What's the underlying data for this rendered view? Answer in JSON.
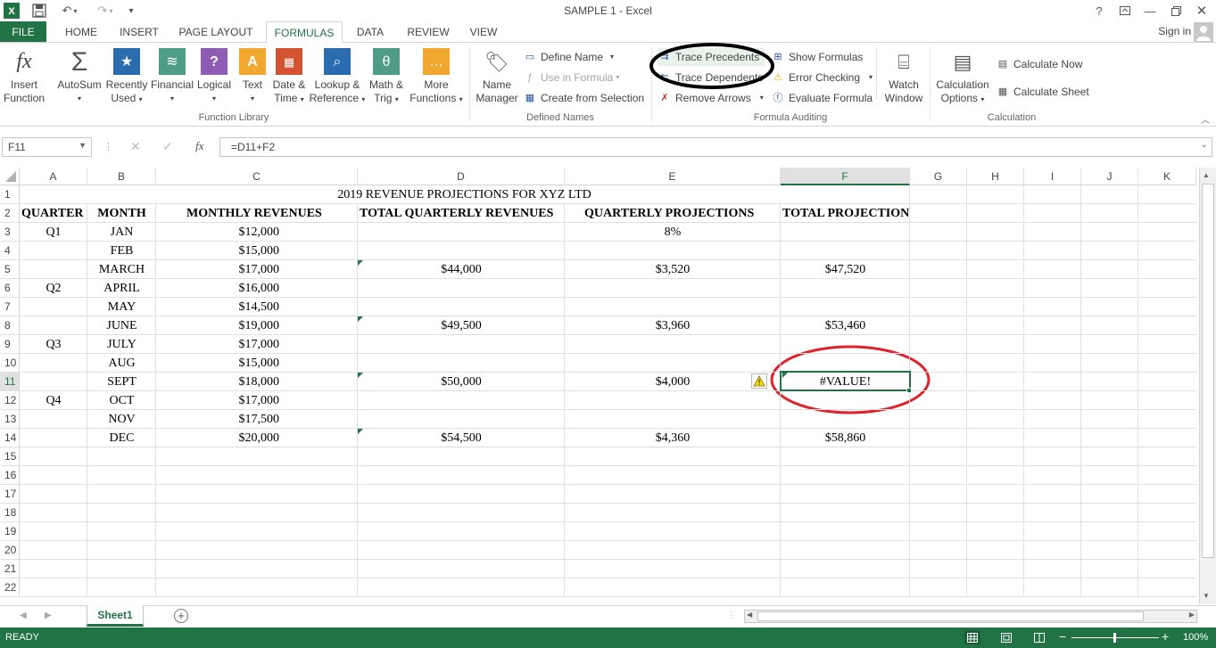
{
  "window": {
    "title": "SAMPLE 1 - Excel",
    "help_label": "?",
    "sign_in": "Sign in"
  },
  "tabs": [
    {
      "label": "FILE"
    },
    {
      "label": "HOME"
    },
    {
      "label": "INSERT"
    },
    {
      "label": "PAGE LAYOUT"
    },
    {
      "label": "FORMULAS",
      "active": true
    },
    {
      "label": "DATA"
    },
    {
      "label": "REVIEW"
    },
    {
      "label": "VIEW"
    }
  ],
  "ribbon": {
    "function_library": {
      "label": "Function Library",
      "insert_function": {
        "line1": "Insert",
        "line2": "Function",
        "icon": "fx-icon"
      },
      "autosum": {
        "line1": "AutoSum",
        "icon": "sigma-icon"
      },
      "recently_used": {
        "line1": "Recently",
        "line2": "Used",
        "icon": "star-book-icon"
      },
      "financial": {
        "line1": "Financial",
        "icon": "coins-book-icon"
      },
      "logical": {
        "line1": "Logical",
        "icon": "question-book-icon"
      },
      "text": {
        "line1": "Text",
        "icon": "text-book-icon"
      },
      "date_time": {
        "line1": "Date &",
        "line2": "Time",
        "icon": "calendar-book-icon"
      },
      "lookup_reference": {
        "line1": "Lookup &",
        "line2": "Reference",
        "icon": "magnifier-book-icon"
      },
      "math_trig": {
        "line1": "Math &",
        "line2": "Trig",
        "icon": "theta-book-icon"
      },
      "more_functions": {
        "line1": "More",
        "line2": "Functions",
        "icon": "ellipsis-book-icon"
      }
    },
    "defined_names": {
      "label": "Defined Names",
      "name_manager": {
        "line1": "Name",
        "line2": "Manager"
      },
      "define_name": "Define Name",
      "use_in_formula": "Use in Formula",
      "create_from_selection": "Create from Selection"
    },
    "formula_auditing": {
      "label": "Formula Auditing",
      "trace_precedents": "Trace Precedents",
      "trace_dependents": "Trace Dependents",
      "remove_arrows": "Remove Arrows",
      "show_formulas": "Show Formulas",
      "error_checking": "Error Checking",
      "evaluate_formula": "Evaluate Formula",
      "watch_window": {
        "line1": "Watch",
        "line2": "Window"
      }
    },
    "calculation": {
      "label": "Calculation",
      "calculation_options": {
        "line1": "Calculation",
        "line2": "Options"
      },
      "calculate_now": "Calculate Now",
      "calculate_sheet": "Calculate Sheet"
    }
  },
  "formula_bar": {
    "name_box": "F11",
    "fx": "fx",
    "formula": "=D11+F2"
  },
  "columns": [
    "A",
    "B",
    "C",
    "D",
    "E",
    "F",
    "G",
    "H",
    "I",
    "J",
    "K"
  ],
  "rows": [
    "1",
    "2",
    "3",
    "4",
    "5",
    "6",
    "7",
    "8",
    "9",
    "10",
    "11",
    "12",
    "13",
    "14",
    "15",
    "16",
    "17",
    "18",
    "19",
    "20",
    "21",
    "22"
  ],
  "sheet": {
    "title": "2019 REVENUE PROJECTIONS FOR XYZ LTD",
    "headers": [
      "QUARTER",
      "MONTH",
      "MONTHLY REVENUES",
      "TOTAL QUARTERLY REVENUES",
      "QUARTERLY PROJECTIONS",
      "TOTAL PROJECTION"
    ],
    "data": [
      {
        "quarter": "Q1",
        "month": "JAN",
        "revenue": "$12,000",
        "total_q": "",
        "proj": "8%",
        "total_proj": ""
      },
      {
        "quarter": "",
        "month": "FEB",
        "revenue": "$15,000",
        "total_q": "",
        "proj": "",
        "total_proj": ""
      },
      {
        "quarter": "",
        "month": "MARCH",
        "revenue": "$17,000",
        "total_q": "$44,000",
        "proj": "$3,520",
        "total_proj": "$47,520"
      },
      {
        "quarter": "Q2",
        "month": "APRIL",
        "revenue": "$16,000",
        "total_q": "",
        "proj": "",
        "total_proj": ""
      },
      {
        "quarter": "",
        "month": "MAY",
        "revenue": "$14,500",
        "total_q": "",
        "proj": "",
        "total_proj": ""
      },
      {
        "quarter": "",
        "month": "JUNE",
        "revenue": "$19,000",
        "total_q": "$49,500",
        "proj": "$3,960",
        "total_proj": "$53,460"
      },
      {
        "quarter": "Q3",
        "month": "JULY",
        "revenue": "$17,000",
        "total_q": "",
        "proj": "",
        "total_proj": ""
      },
      {
        "quarter": "",
        "month": "AUG",
        "revenue": "$15,000",
        "total_q": "",
        "proj": "",
        "total_proj": ""
      },
      {
        "quarter": "",
        "month": "SEPT",
        "revenue": "$18,000",
        "total_q": "$50,000",
        "proj": "$4,000",
        "total_proj": "#VALUE!"
      },
      {
        "quarter": "Q4",
        "month": "OCT",
        "revenue": "$17,000",
        "total_q": "",
        "proj": "",
        "total_proj": ""
      },
      {
        "quarter": "",
        "month": "NOV",
        "revenue": "$17,500",
        "total_q": "",
        "proj": "",
        "total_proj": ""
      },
      {
        "quarter": "",
        "month": "DEC",
        "revenue": "$20,000",
        "total_q": "$54,500",
        "proj": "$4,360",
        "total_proj": "$58,860"
      }
    ]
  },
  "sheet_tabs": [
    {
      "label": "Sheet1",
      "active": true
    }
  ],
  "status": {
    "ready": "READY",
    "zoom": "100%"
  },
  "colors": {
    "excel_green": "#217346",
    "annotation_black": "#000000",
    "annotation_red": "#e0202a"
  }
}
